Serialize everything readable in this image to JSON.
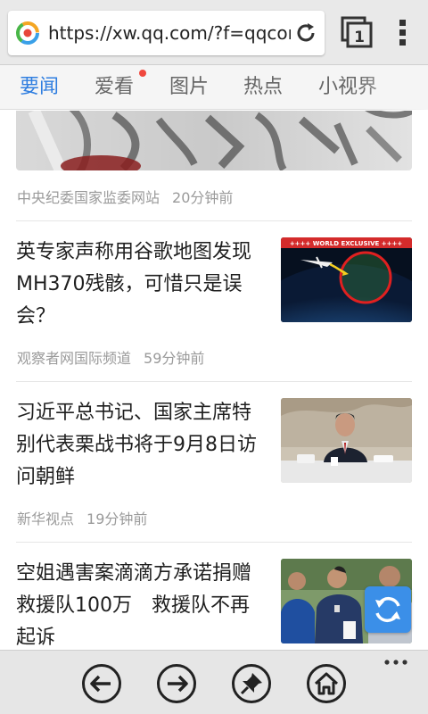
{
  "browser": {
    "url": "https://xw.qq.com/?f=qqcom",
    "tab_count": "1"
  },
  "nav": {
    "items": [
      {
        "label": "要闻",
        "active": true
      },
      {
        "label": "爱看",
        "active": false,
        "has_dot": true
      },
      {
        "label": "图片",
        "active": false
      },
      {
        "label": "热点",
        "active": false
      },
      {
        "label": "小视界",
        "active": false
      }
    ]
  },
  "feed": {
    "hero": {
      "source": "中央纪委国家监委网站",
      "time": "20分钟前"
    },
    "articles": [
      {
        "title": "英专家声称用谷歌地图发现MH370残骸，可惜只是误会？",
        "source": "观察者网国际频道",
        "time": "59分钟前",
        "thumb_caption": "++++ WORLD EXCLUSIVE ++++"
      },
      {
        "title": "习近平总书记、国家主席特别代表栗战书将于9月8日访问朝鲜",
        "source": "新华视点",
        "time": "19分钟前"
      },
      {
        "title": "空姐遇害案滴滴方承诺捐赠救援队100万　救援队不再起诉"
      }
    ]
  },
  "colors": {
    "accent": "#2f7ee0",
    "badge": "#f0483e",
    "refresh": "#3b8fe8"
  },
  "icons": {
    "site": "tencent-news-icon",
    "reload": "reload-icon",
    "tabs": "tabs-icon",
    "menu": "overflow-menu-icon",
    "back": "back-arrow-icon",
    "forward": "forward-arrow-icon",
    "pin": "pin-icon",
    "home": "home-icon",
    "refresh": "refresh-icon"
  }
}
